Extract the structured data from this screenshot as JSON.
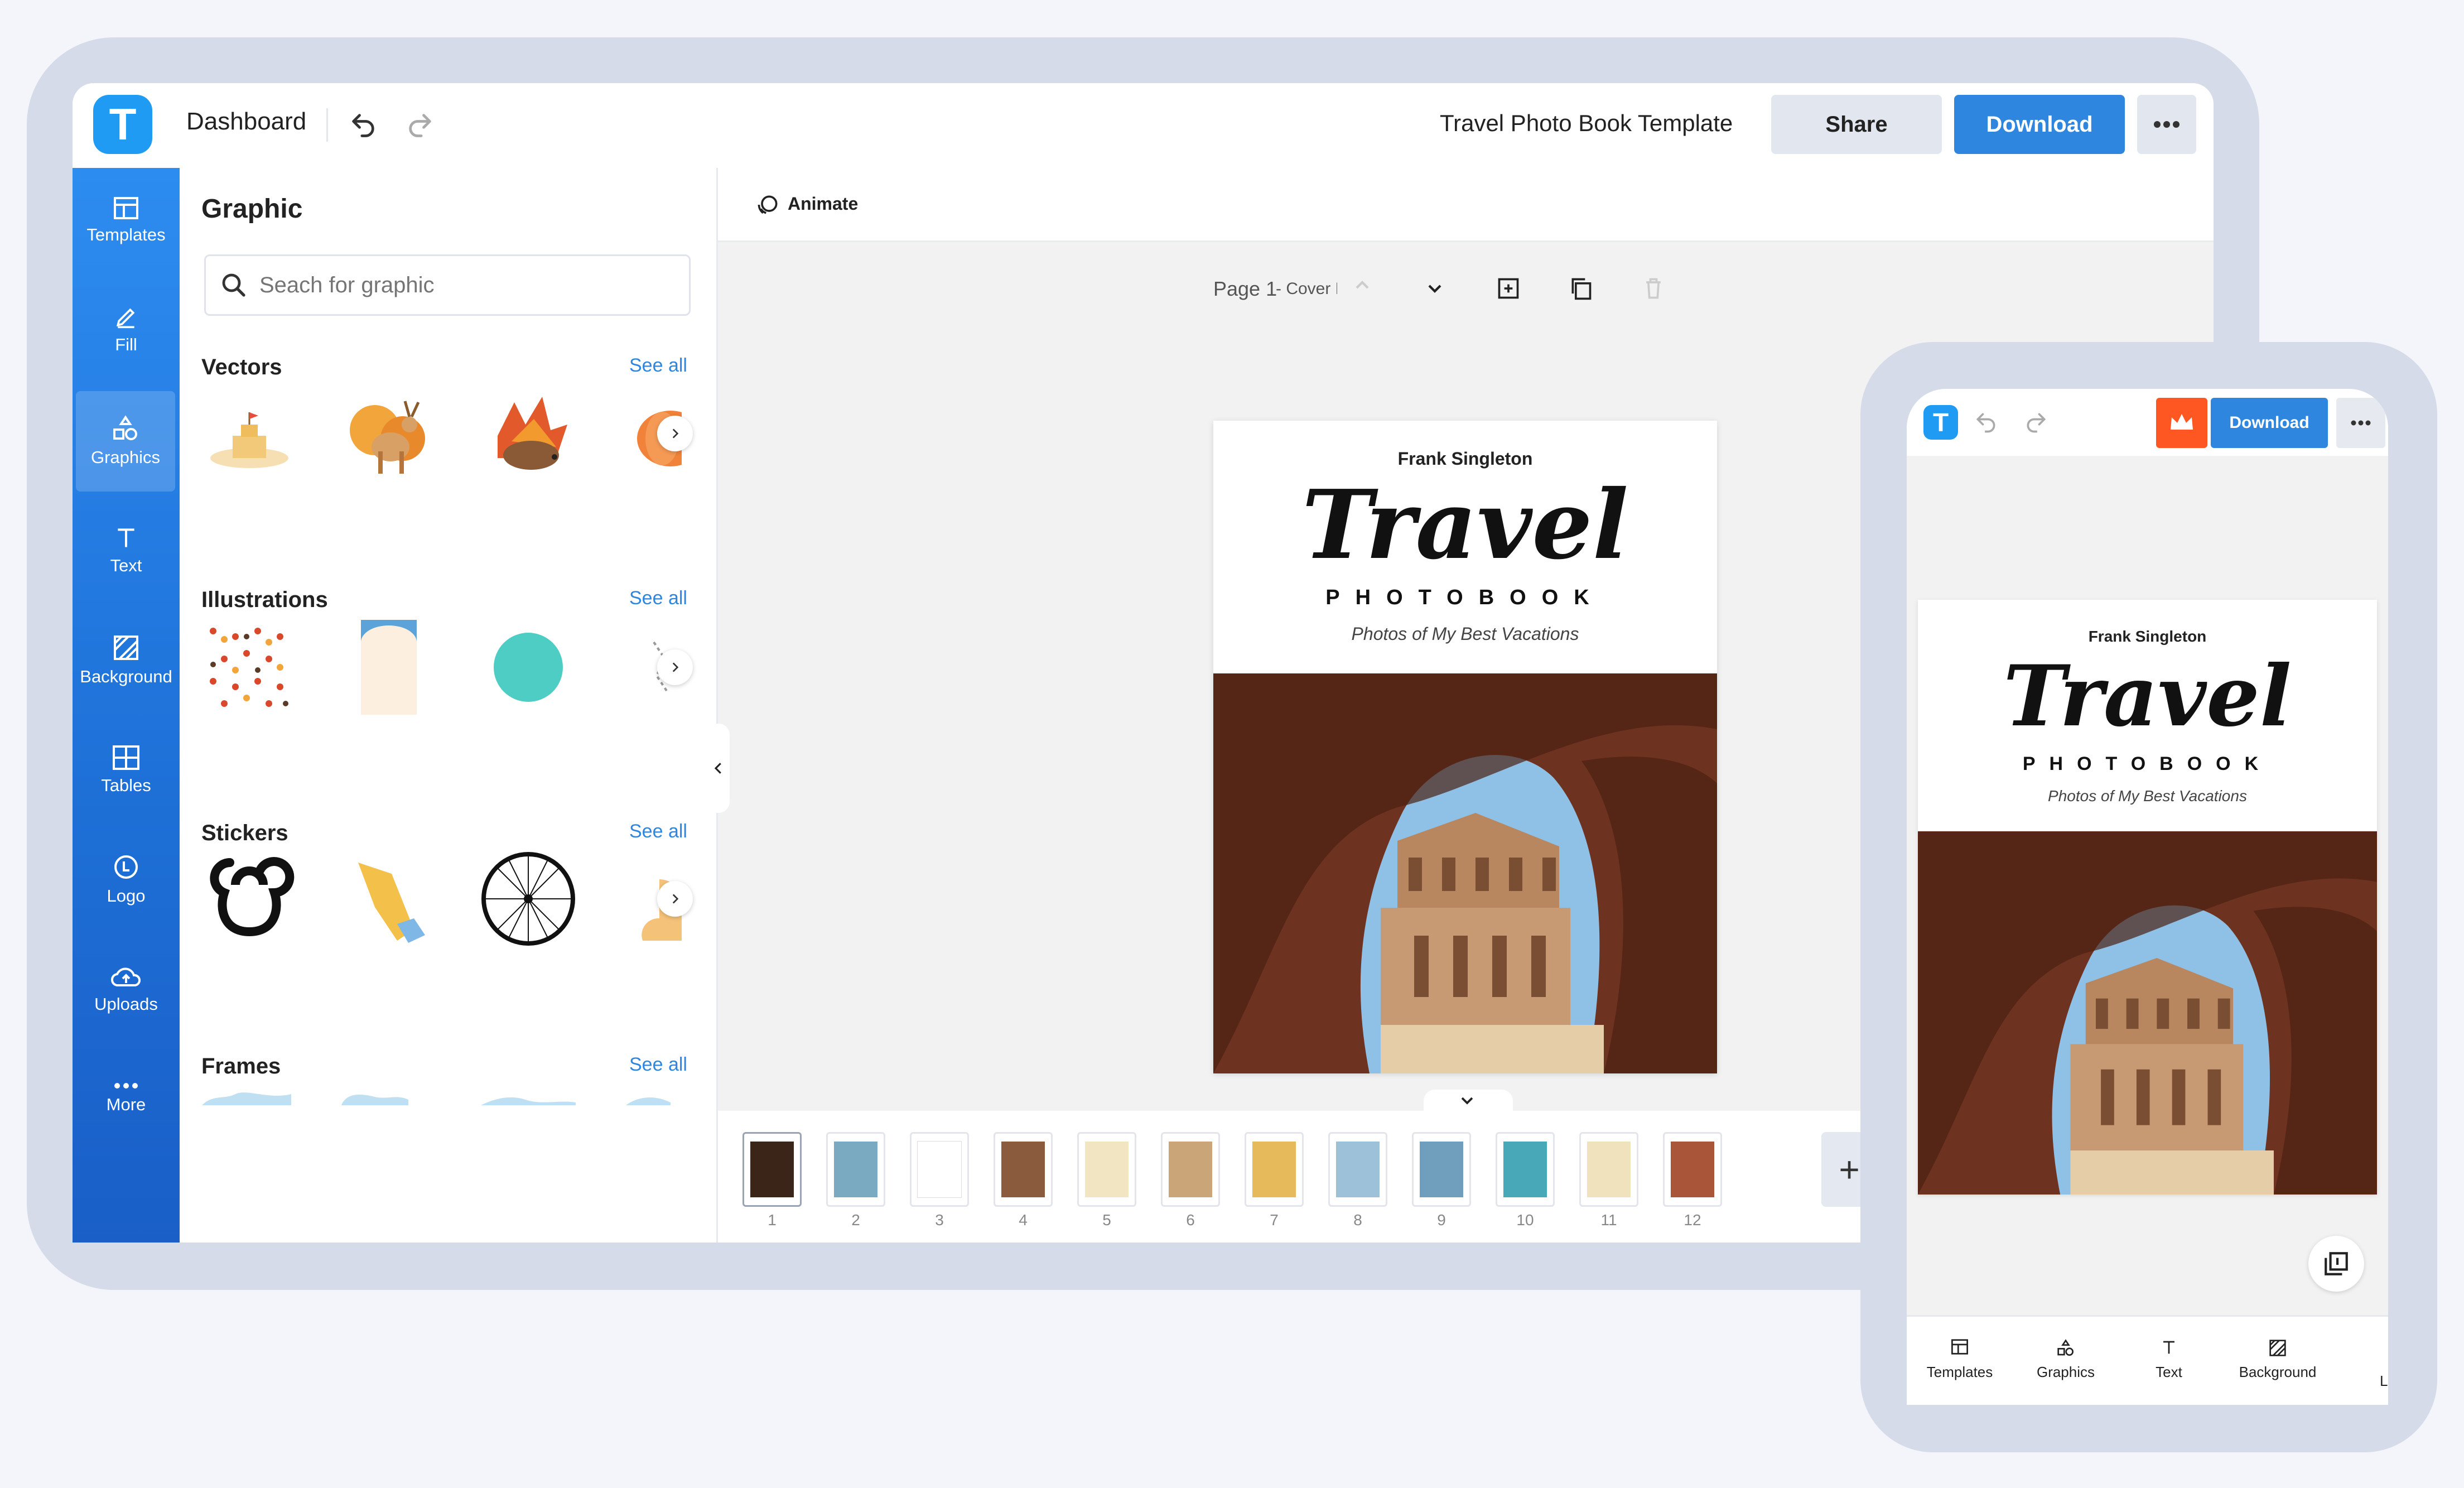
{
  "app": {
    "logo_letter": "T",
    "dashboard_label": "Dashboard",
    "document_title": "Travel Photo Book Template",
    "share_label": "Share",
    "download_label": "Download"
  },
  "sidebar": {
    "items": [
      {
        "label": "Templates",
        "icon": "templates-icon"
      },
      {
        "label": "Fill",
        "icon": "pencil-icon"
      },
      {
        "label": "Graphics",
        "icon": "shapes-icon"
      },
      {
        "label": "Text",
        "icon": "text-icon"
      },
      {
        "label": "Background",
        "icon": "background-icon"
      },
      {
        "label": "Tables",
        "icon": "table-icon"
      },
      {
        "label": "Logo",
        "icon": "logo-icon"
      },
      {
        "label": "Uploads",
        "icon": "upload-cloud-icon"
      },
      {
        "label": "More",
        "icon": "more-dots-icon"
      }
    ],
    "active": "Graphics"
  },
  "panel": {
    "title": "Graphic",
    "search_placeholder": "Seach for graphic",
    "sections": [
      {
        "title": "Vectors",
        "see_all": "See all"
      },
      {
        "title": "Illustrations",
        "see_all": "See all"
      },
      {
        "title": "Stickers",
        "see_all": "See all"
      },
      {
        "title": "Frames",
        "see_all": "See all"
      }
    ]
  },
  "workspace": {
    "animate_label": "Animate",
    "page_label": "Page 1",
    "page_name": "- Cover F"
  },
  "cover": {
    "author": "Frank Singleton",
    "title": "Travel",
    "subtitle_caps": "PHOTOBOOK",
    "tagline": "Photos of My Best Vacations"
  },
  "pages": {
    "numbers": [
      "1",
      "2",
      "3",
      "4",
      "5",
      "6",
      "7",
      "8",
      "9",
      "10",
      "11",
      "12"
    ],
    "add_label": "+"
  },
  "phone": {
    "logo_letter": "T",
    "download_label": "Download",
    "nav": [
      {
        "label": "Templates",
        "icon": "templates-icon"
      },
      {
        "label": "Graphics",
        "icon": "shapes-icon"
      },
      {
        "label": "Text",
        "icon": "text-icon"
      },
      {
        "label": "Background",
        "icon": "background-icon"
      }
    ],
    "nav_cut_off": "L"
  },
  "colors": {
    "accent": "#2e86de",
    "sidebar": "#1d6fd6",
    "premium": "#ff5722"
  }
}
